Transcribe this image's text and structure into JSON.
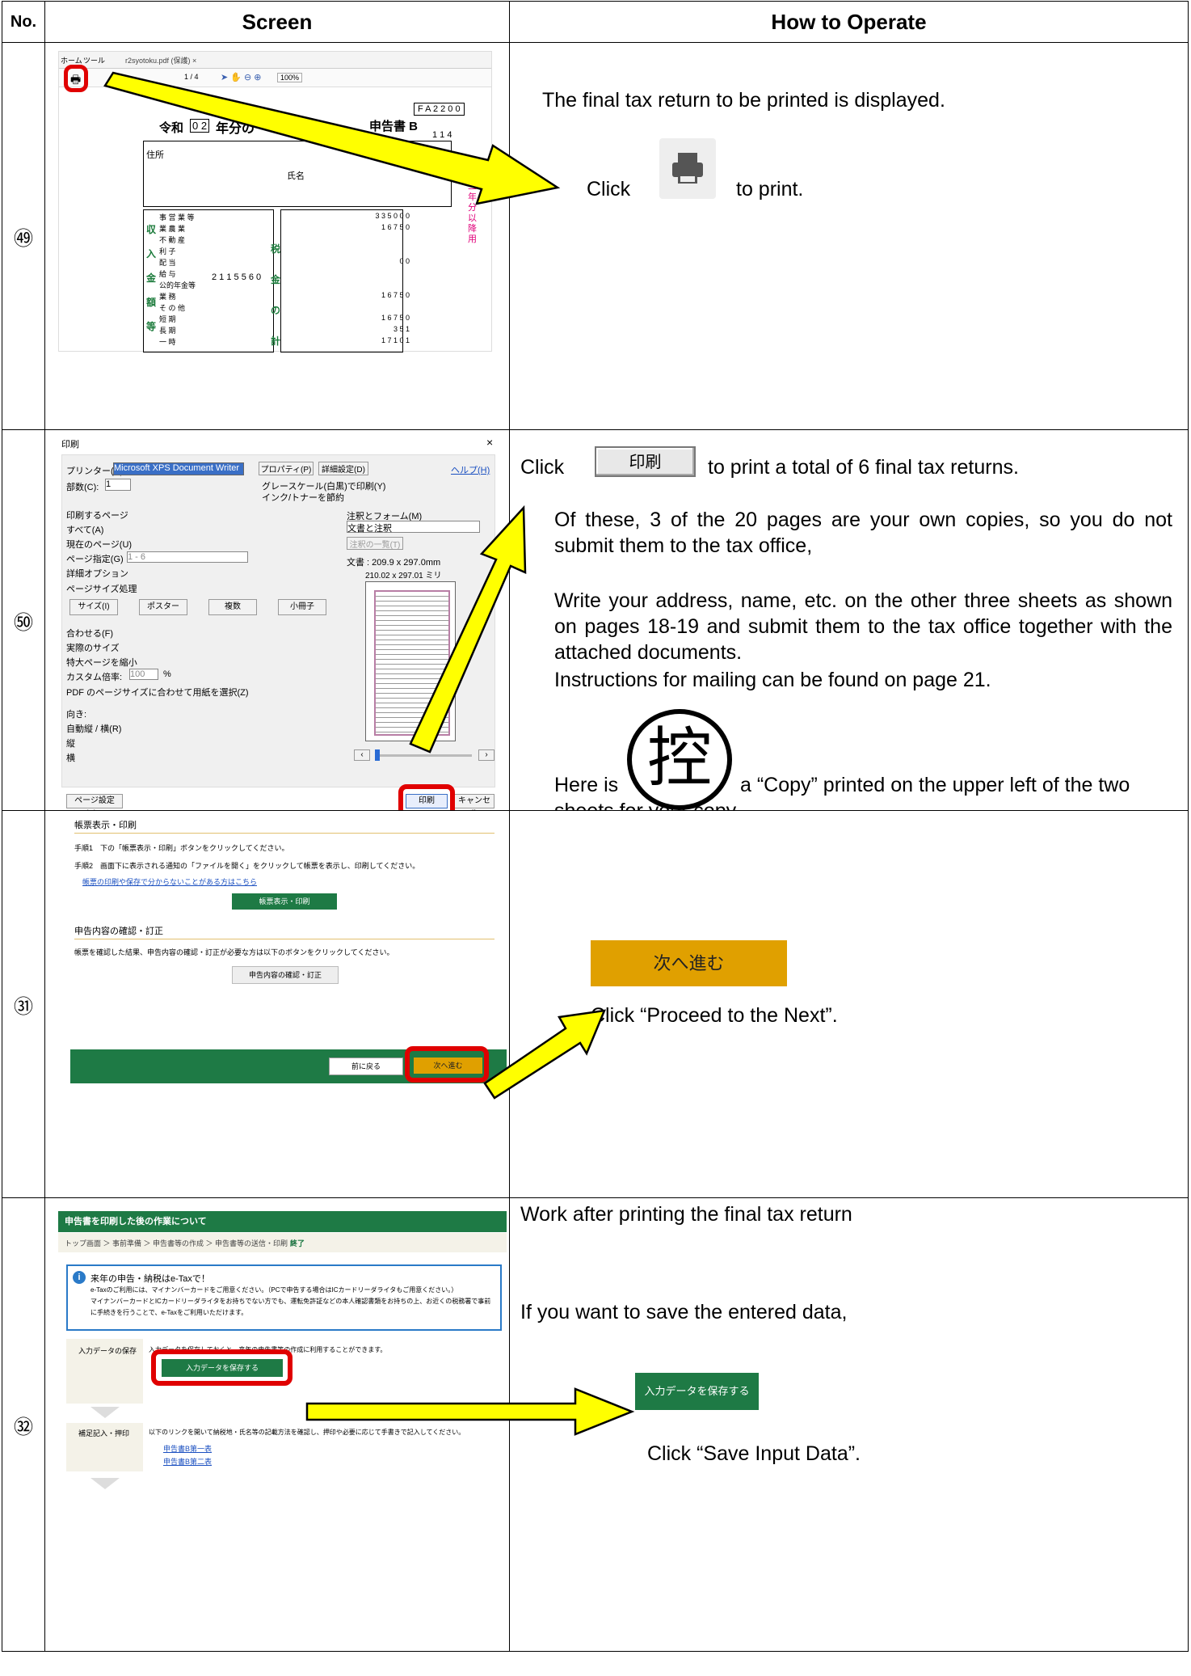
{
  "header": {
    "no": "No.",
    "screen": "Screen",
    "how": "How to Operate"
  },
  "rows": [
    {
      "no": "㊾",
      "screen": {
        "tab_home": "ホーム",
        "tab_tools": "ツール",
        "tab_file": "r2syotoku.pdf (保護) ×",
        "zoom": "100%",
        "page": "1 / 4",
        "form_era": "令和",
        "form_year": "0 2",
        "form_title_prefix": "年分の",
        "form_title_suffix": "申告書 B",
        "form_code": "F A 2 2 0 0",
        "form_code2": "1 1 4",
        "label_address": "住所",
        "label_name": "氏名",
        "income_labels": [
          "事 営 業 等",
          "業 農 業",
          "不 動 産",
          "利 子",
          "配 当",
          "給 与",
          "公的年金等",
          "業 務",
          "そ の 他",
          "短 期",
          "長 期",
          "一 時"
        ],
        "income_value": "2 1 1 5 5 6 0",
        "tax_values": [
          "3 3 5 0 0 0",
          "1 6 7 5 0",
          "0 0",
          "1 6 7 5 0",
          "1 6 7 5 0",
          "3 5 1",
          "1 7 1 0 1"
        ],
        "side_section": [
          "収",
          "入",
          "金",
          "額",
          "等"
        ],
        "side_tax": [
          "税",
          "金",
          "の",
          "計"
        ],
        "side_red": "令和二年分以降用"
      },
      "how": {
        "line1": "The final tax return to be printed is displayed.",
        "click": "Click",
        "suffix": "to print."
      }
    },
    {
      "no": "㊿",
      "screen": {
        "title": "印刷",
        "close": "×",
        "printer_label": "プリンター(N):",
        "printer_value": "Microsoft XPS Document Writer",
        "properties": "プロパティ(P)",
        "advanced": "詳細設定(D)",
        "help": "ヘルプ(H)",
        "copies_label": "部数(C):",
        "copies_value": "1",
        "grayscale": "グレースケール(白黒)で印刷(Y)",
        "ink_save": "インク/トナーを節約",
        "pages_title": "印刷するページ",
        "pages_options": [
          "すべて(A)",
          "現在のページ(U)",
          "ページ指定(G)",
          "詳細オプション"
        ],
        "page_range": "1 - 6",
        "sizing_title": "ページサイズ処理",
        "sizing_buttons": [
          "サイズ(I)",
          "ポスター",
          "複数",
          "小冊子"
        ],
        "fit_options": [
          "合わせる(F)",
          "実際のサイズ",
          "特大ページを縮小",
          "カスタム倍率:"
        ],
        "custom_scale": "100",
        "percent": "%",
        "pdf_size": "PDF のページサイズに合わせて用紙を選択(Z)",
        "orient_title": "向き:",
        "orient_options": [
          "自動縦 / 横(R)",
          "縦",
          "横"
        ],
        "comments_title": "注釈とフォーム(M)",
        "comments_value": "文書と注釈",
        "comments_list": "注釈の一覧(T)",
        "doc_size": "文書 : 209.9 x 297.0mm",
        "paper_size": "210.02 x 297.01 ミリ",
        "page_setup": "ページ設定(S)...",
        "print": "印刷",
        "cancel": "キャンセル"
      },
      "how": {
        "click": "Click",
        "button": "印刷",
        "line1_suffix": "to print a total of 6 final tax returns.",
        "p1": "Of these, 3 of the 20 pages are your own copies, so you do not submit them to the tax office,",
        "p2": "Write your address, name, etc. on the other three sheets as shown on pages 18-19 and submit them to the tax office together with the attached documents.",
        "p3": "Instructions for mailing can be found on page 21.",
        "stamp": "控",
        "copy_prefix": "Here is",
        "copy_suffix": "a “Copy” printed on the upper left of the two sheets for your copy."
      }
    },
    {
      "no": "㉛",
      "screen": {
        "title": "帳票表示・印刷",
        "step1": "手順1　下の「帳票表示・印刷」ボタンをクリックしてください。",
        "step2": "手順2　画面下に表示される通知の「ファイルを開く」をクリックして帳票を表示し、印刷してください。",
        "help_link": "帳票の印刷や保存で分からないことがある方はこちら",
        "btn_print": "帳票表示・印刷",
        "section2": "申告内容の確認・訂正",
        "desc2": "帳票を確認した結果、申告内容の確認・訂正が必要な方は以下のボタンをクリックしてください。",
        "btn_confirm": "申告内容の確認・訂正",
        "back": "前に戻る",
        "next": "次へ進む"
      },
      "how": {
        "button": "次へ進む",
        "text": "Click “Proceed to the Next”."
      }
    },
    {
      "no": "㉜",
      "screen": {
        "header": "申告書を印刷した後の作業について",
        "crumbs": "トップ画面 ＞ 事前準備 ＞ 申告書等の作成 ＞ 申告書等の送信・印刷 ＞",
        "crumb_last": "終了",
        "info_title": "来年の申告・納税はe-Taxで！",
        "info1": "e-Taxのご利用には、マイナンバーカードをご用意ください。（PCで申告する場合はICカードリーダライタもご用意ください。）",
        "info2": "マイナンバーカードとICカードリーダライタをお持ちでない方でも、運転免許証などの本人確認書類をお持ちの上、お近くの税務署で事前",
        "info3": "に手続きを行うことで、e-Taxをご利用いただけます。",
        "save_label": "入力データの保存",
        "save_desc": "入力データを保存しておくと、来年の申告書等の作成に利用することができます。",
        "save_btn": "入力データを保存する",
        "supp_label": "補足記入・押印",
        "supp_desc": "以下のリンクを開いて納税地・氏名等の記載方法を確認し、押印や必要に応じて手書きで記入してください。",
        "links": [
          "申告書B第一表",
          "申告書B第二表"
        ]
      },
      "how": {
        "title": "Work after printing the final tax return",
        "p1": "If you want to save the entered data,",
        "button": "入力データを保存する",
        "text": "Click “Save Input Data”."
      }
    }
  ],
  "colors": {
    "arrow_fill": "#ffff00",
    "highlight": "#e00000",
    "green": "#1e7a45",
    "orange": "#e0a000"
  }
}
